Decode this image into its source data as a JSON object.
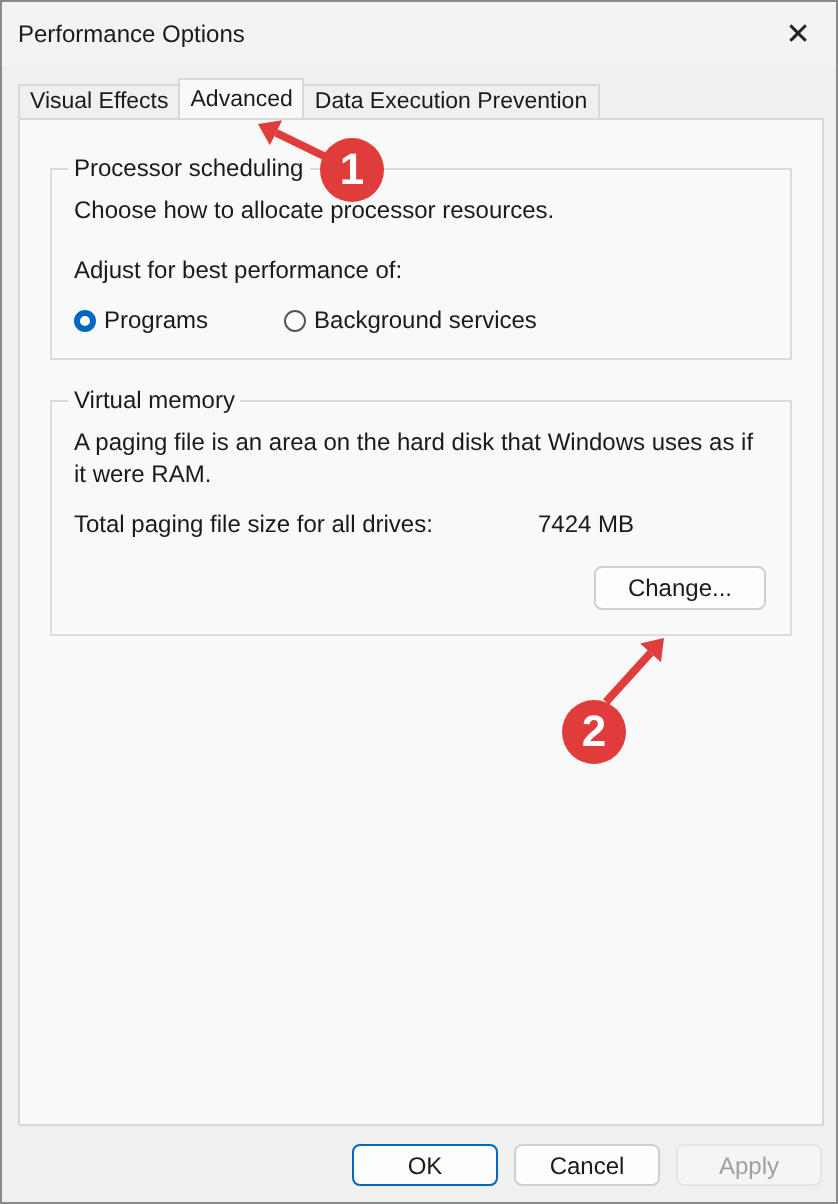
{
  "window": {
    "title": "Performance Options",
    "close": "✕"
  },
  "tabs": [
    {
      "label": "Visual Effects",
      "selected": false
    },
    {
      "label": "Advanced",
      "selected": true
    },
    {
      "label": "Data Execution Prevention",
      "selected": false
    }
  ],
  "processor_scheduling": {
    "title": "Processor scheduling",
    "description": "Choose how to allocate processor resources.",
    "prompt": "Adjust for best performance of:",
    "options": [
      {
        "label": "Programs",
        "selected": true
      },
      {
        "label": "Background services",
        "selected": false
      }
    ]
  },
  "virtual_memory": {
    "title": "Virtual memory",
    "description": "A paging file is an area on the hard disk that Windows uses as if it were RAM.",
    "size_label": "Total paging file size for all drives:",
    "size_value": "7424 MB",
    "button": "Change..."
  },
  "buttons": [
    {
      "label": "OK",
      "default": true,
      "disabled": false
    },
    {
      "label": "Cancel",
      "default": false,
      "disabled": false
    },
    {
      "label": "Apply",
      "default": false,
      "disabled": true
    }
  ],
  "annotations": [
    {
      "label": "1"
    },
    {
      "label": "2"
    }
  ]
}
